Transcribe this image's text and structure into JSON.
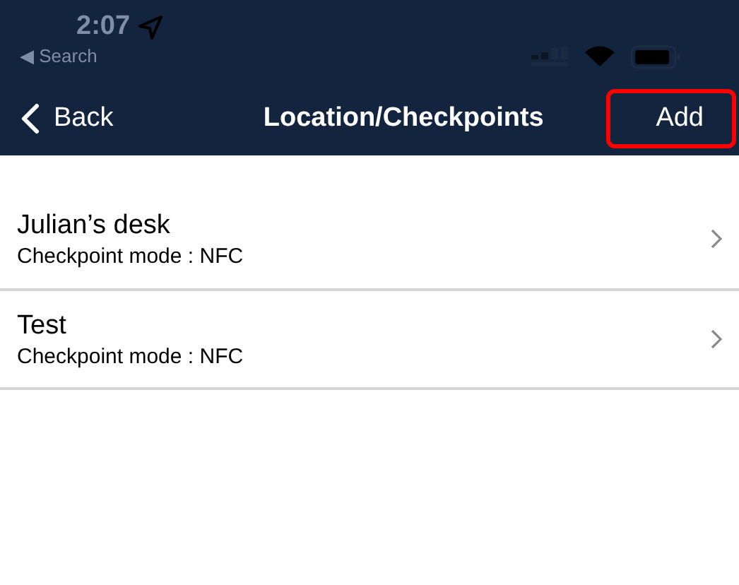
{
  "status_bar": {
    "time": "2:07",
    "back_link": "◀ Search"
  },
  "nav_bar": {
    "back": "Back",
    "title": "Location/Checkpoints",
    "action": {
      "label": "Add",
      "highlighted": true
    }
  },
  "items": [
    {
      "title": "Julian’s desk",
      "subtitle": "Checkpoint mode : NFC"
    },
    {
      "title": "Test",
      "subtitle": "Checkpoint mode : NFC"
    }
  ]
}
